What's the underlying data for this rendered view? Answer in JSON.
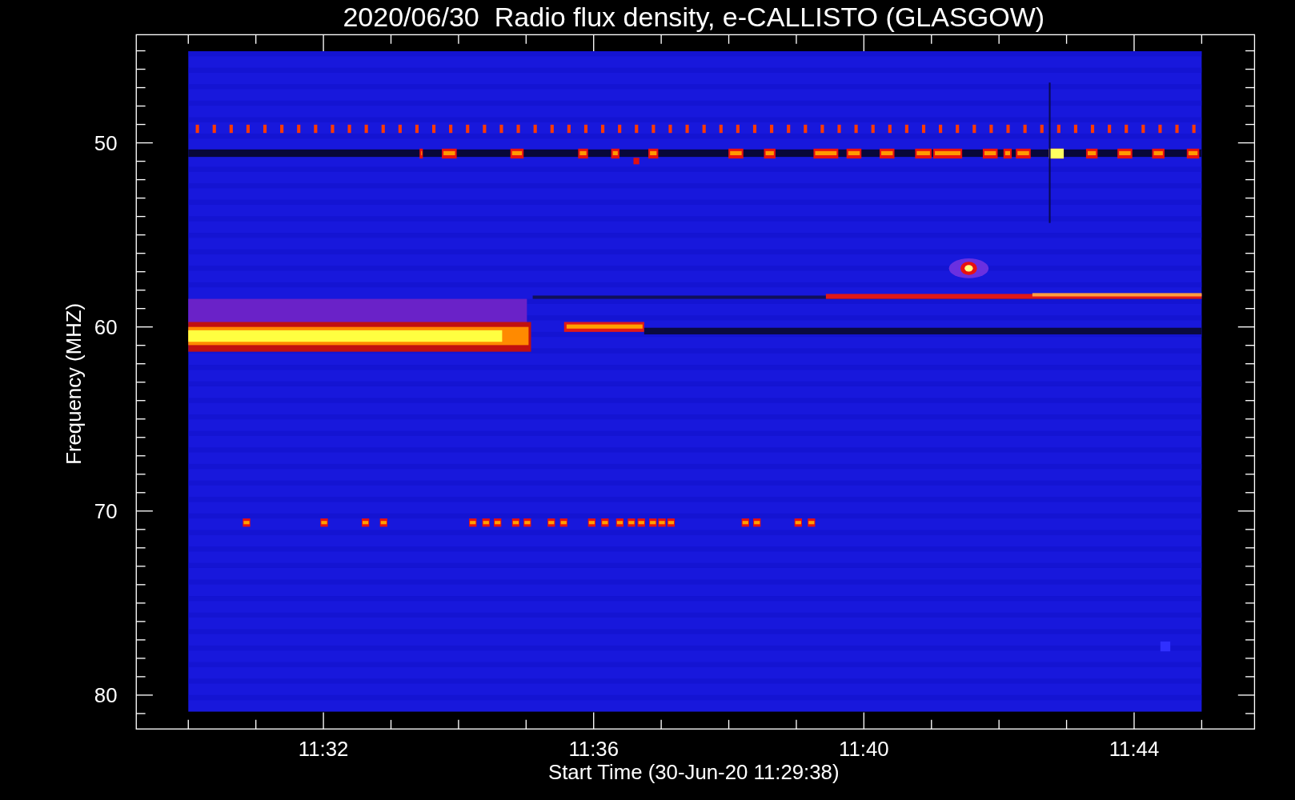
{
  "title": "2020/06/30  Radio flux density, e-CALLISTO (GLASGOW)",
  "y_axis": {
    "label": "Frequency (MHZ)",
    "ticks": [
      "50",
      "60",
      "70",
      "80"
    ]
  },
  "x_axis": {
    "label": "Start Time (30-Jun-20 11:29:38)",
    "ticks": [
      "11:32",
      "11:36",
      "11:40",
      "11:44"
    ]
  }
}
